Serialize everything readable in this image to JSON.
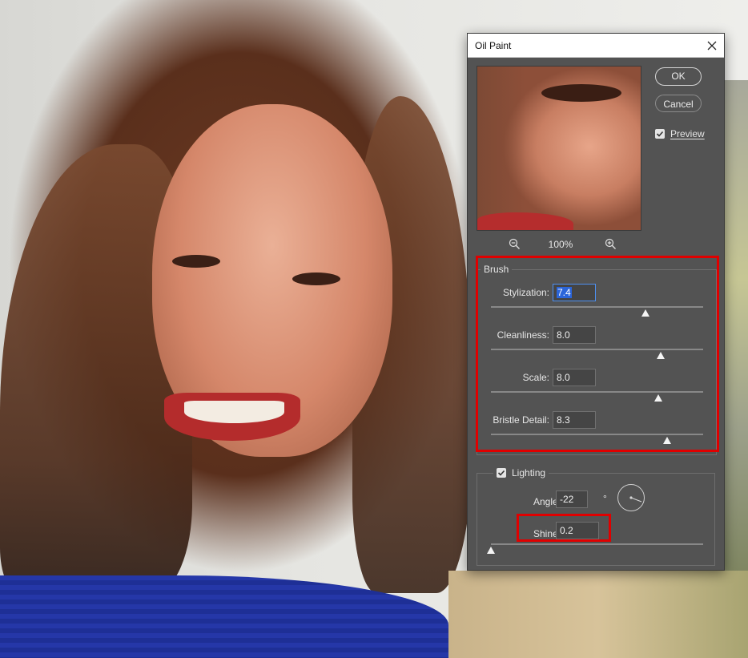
{
  "dialog": {
    "title": "Oil Paint",
    "ok_label": "OK",
    "cancel_label": "Cancel",
    "preview_label": "Preview",
    "preview_checked": true,
    "zoom_level": "100%"
  },
  "brush": {
    "legend": "Brush",
    "fields": [
      {
        "label": "Stylization:",
        "value": "7.4",
        "slider_fraction": 0.73
      },
      {
        "label": "Cleanliness:",
        "value": "8.0",
        "slider_fraction": 0.8
      },
      {
        "label": "Scale:",
        "value": "8.0",
        "slider_fraction": 0.79
      },
      {
        "label": "Bristle Detail:",
        "value": "8.3",
        "slider_fraction": 0.83
      }
    ]
  },
  "lighting": {
    "legend": "Lighting",
    "checked": true,
    "angle_label": "Angle:",
    "angle_value": "-22",
    "degree_symbol": "°",
    "shine_label": "Shine:",
    "shine_value": "0.2",
    "shine_slider_fraction": 0.0
  },
  "colors": {
    "highlight": "#e00000",
    "dialog_bg": "#535353",
    "selection": "#2b65d9"
  }
}
